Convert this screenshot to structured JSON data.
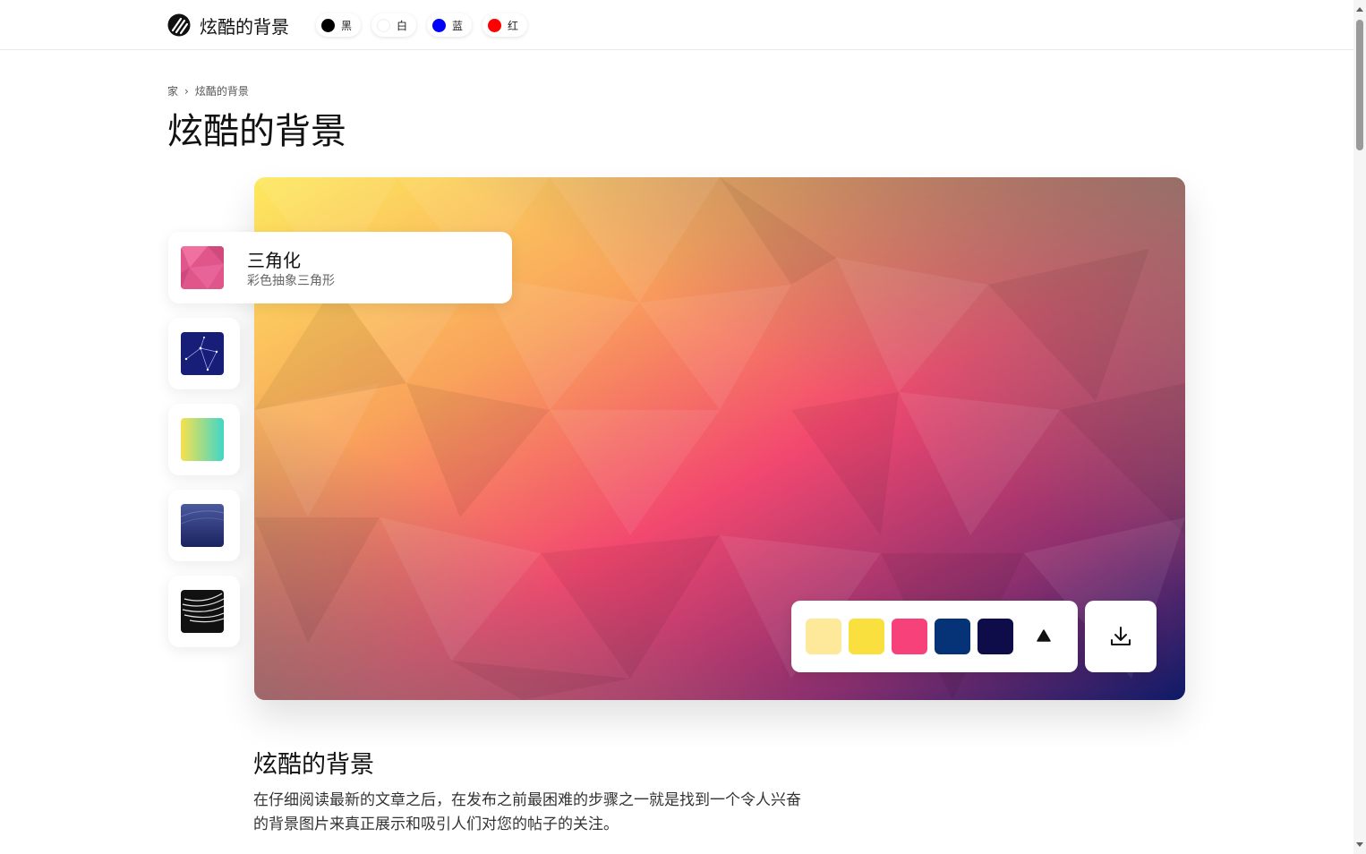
{
  "header": {
    "brand": "炫酷的背景",
    "themes": [
      {
        "label": "黑",
        "color": "#000000"
      },
      {
        "label": "白",
        "color": "#ffffff"
      },
      {
        "label": "蓝",
        "color": "#0000ff"
      },
      {
        "label": "红",
        "color": "#ff0000"
      }
    ]
  },
  "breadcrumb": {
    "home": "家",
    "separator": "›",
    "current": "炫酷的背景"
  },
  "page_title": "炫酷的背景",
  "patterns": [
    {
      "name": "三角化",
      "description": "彩色抽象三角形",
      "icon": "triangulate-thumbnail"
    },
    {
      "icon": "constellation-thumbnail"
    },
    {
      "icon": "gradient-thumbnail"
    },
    {
      "icon": "waves-thumbnail"
    },
    {
      "icon": "spiral-thumbnail"
    }
  ],
  "palette": [
    "#fde999",
    "#f9e03e",
    "#f7417a",
    "#063278",
    "#0e0c49"
  ],
  "icons": {
    "shape": "triangle-icon",
    "download": "download-icon"
  },
  "content": {
    "title": "炫酷的背景",
    "line1": "在仔细阅读最新的文章之后，在发布之前最困难的步骤之一就是找到一个令人兴奋",
    "line2": "的背景图片来真正展示和吸引人们对您的帖子的关注。"
  }
}
